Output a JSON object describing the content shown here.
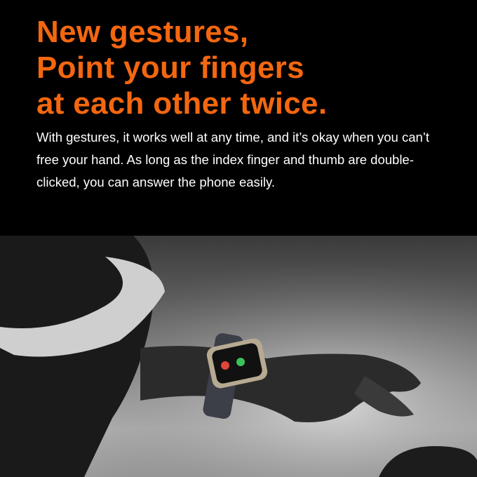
{
  "headline": {
    "lines": [
      "New gestures,",
      "Point your fingers",
      "at each other twice."
    ],
    "color": "#f4670f"
  },
  "description": "With gestures, it works well at any time, and it’s okay when you can’t free your hand. As long as the index finger and thumb are double-clicked, you can answer the phone easily.",
  "photo": {
    "subject": "smartwatch-on-wrist",
    "watch_buttons": {
      "decline_color": "#e0443a",
      "accept_color": "#3cc25a"
    }
  }
}
